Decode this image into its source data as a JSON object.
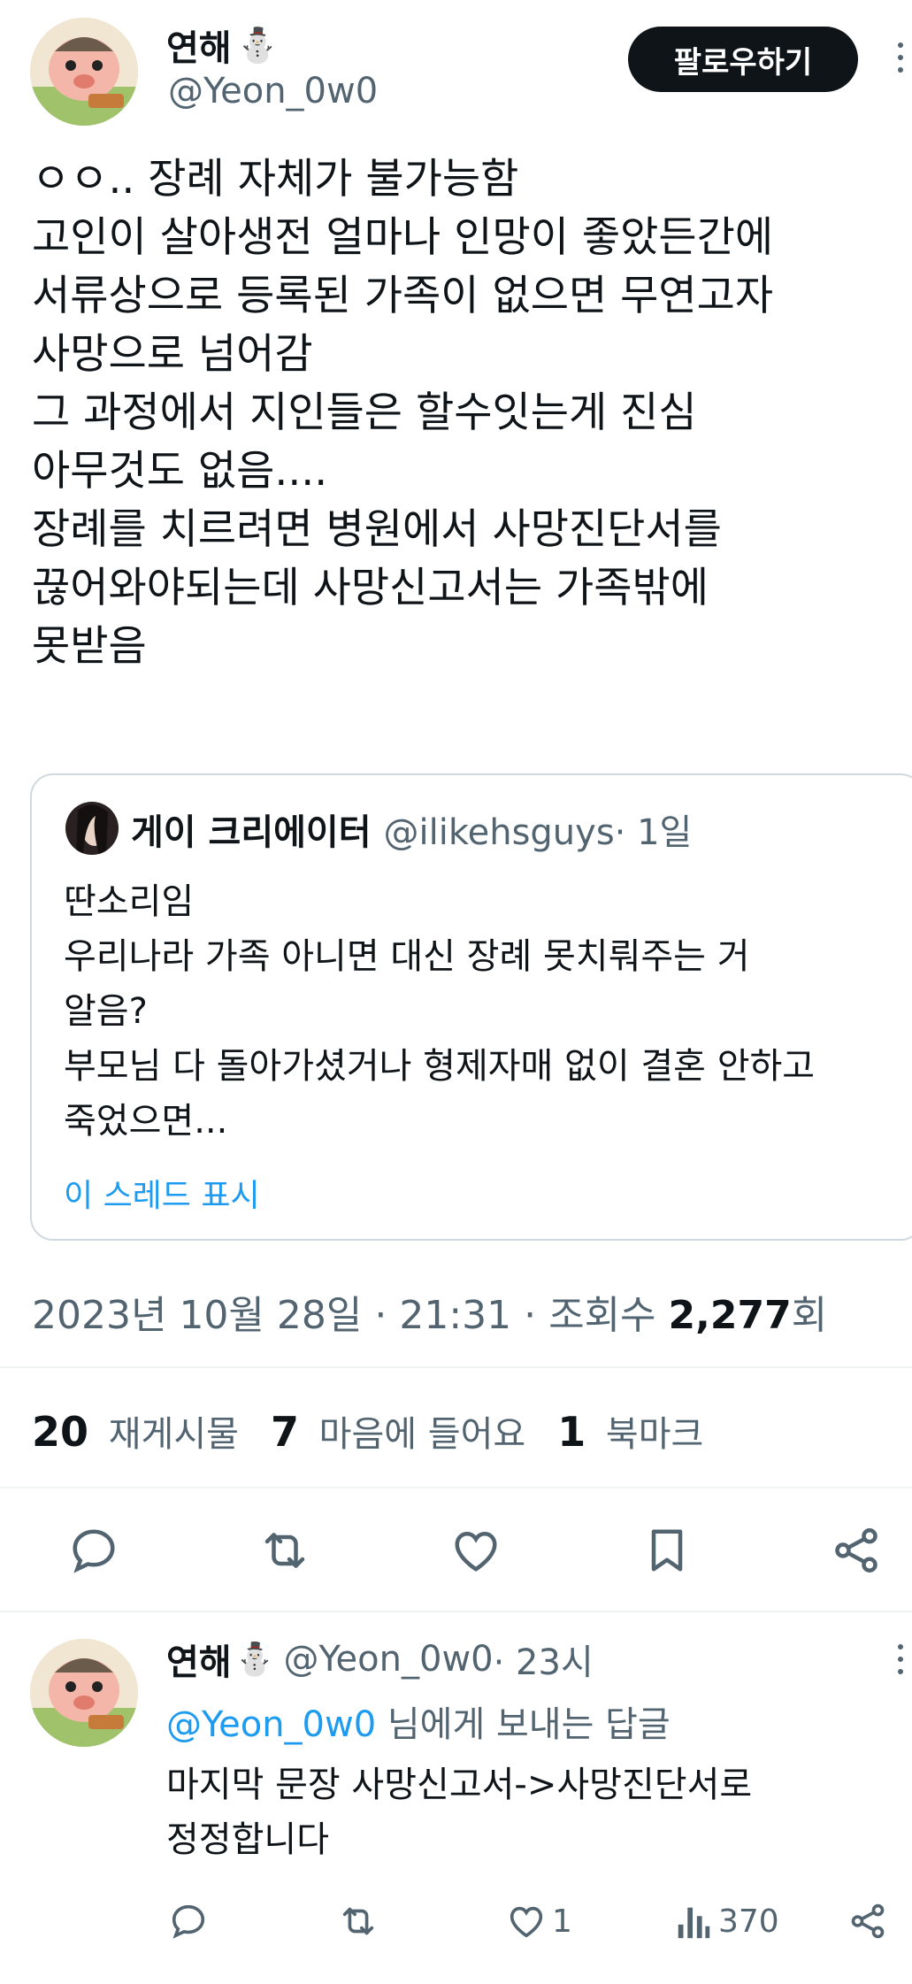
{
  "tweet": {
    "display_name": "연해",
    "name_emoji": "⛄",
    "handle": "@Yeon_0w0",
    "follow_label": "팔로우하기",
    "text": "ㅇㅇ.. 장례 자체가 불가능함\n고인이 살아생전 얼마나 인망이 좋았든간에\n서류상으로 등록된 가족이 없으면 무연고자\n사망으로 넘어감\n그 과정에서 지인들은 할수잇는게 진심\n아무것도 없음....\n장례를 치르려면 병원에서 사망진단서를\n끊어와야되는데 사망신고서는 가족밖에\n못받음",
    "date_prefix": "2023년 10월 28일 · 21:31 · 조회수 ",
    "views": "2,277",
    "views_suffix": "회"
  },
  "quote": {
    "display_name": "게이 크리에이터",
    "handle": "@ilikehsguys",
    "time": " · 1일",
    "text": "딴소리임\n우리나라 가족 아니면 대신 장례 못치뤄주는 거\n알음?\n부모님 다 돌아가셨거나 형제자매 없이 결혼 안하고\n죽었으면...",
    "show_thread": "이 스레드 표시"
  },
  "stats": {
    "retweets_count": "20",
    "retweets_label": "재게시물",
    "likes_count": "7",
    "likes_label": "마음에 들어요",
    "bookmarks_count": "1",
    "bookmarks_label": "북마크"
  },
  "reply": {
    "display_name": "연해",
    "name_emoji": "⛄",
    "handle": "@Yeon_0w0",
    "time": " · 23시",
    "replying_to": "@Yeon_0w0",
    "replying_suffix": " 님에게 보내는 답글",
    "text": "마지막 문장 사망신고서->사망진단서로\n정정합니다",
    "likes": "1",
    "views": "370"
  },
  "colors": {
    "text": "#0f1419",
    "secondary": "#536471",
    "link": "#1d9bf0",
    "border": "#cfd9de"
  }
}
